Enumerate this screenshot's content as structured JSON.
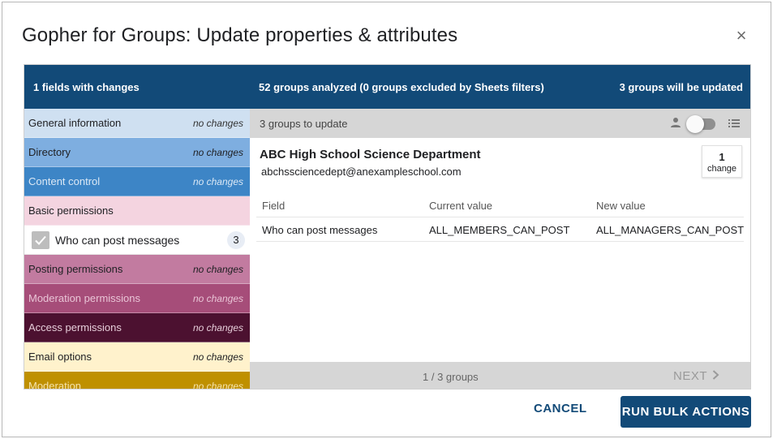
{
  "dialog": {
    "title": "Gopher for Groups: Update properties & attributes",
    "close_label": "×"
  },
  "summary": {
    "fields_with_changes": "1 fields with changes",
    "groups_analyzed": "52 groups analyzed (0 groups excluded by Sheets filters)",
    "groups_will_update": "3 groups will be updated"
  },
  "categories": [
    {
      "name": "General information",
      "status": "no changes",
      "bg": "#cfe0f1",
      "fg": "#202124",
      "nc": "#333333"
    },
    {
      "name": "Directory",
      "status": "no changes",
      "bg": "#7eaee0",
      "fg": "#202124",
      "nc": "#202124"
    },
    {
      "name": "Content control",
      "status": "no changes",
      "bg": "#3d85c6",
      "fg": "#dbe8f5",
      "nc": "#dbe8f5"
    },
    {
      "name": "Basic permissions",
      "status": "",
      "bg": "#f4d4e0",
      "fg": "#202124",
      "nc": "#202124"
    },
    {
      "name": "Posting permissions",
      "status": "no changes",
      "bg": "#c27ba0",
      "fg": "#202124",
      "nc": "#202124"
    },
    {
      "name": "Moderation permissions",
      "status": "no changes",
      "bg": "#a64d79",
      "fg": "#e9c4d6",
      "nc": "#e9c4d6"
    },
    {
      "name": "Access permissions",
      "status": "no changes",
      "bg": "#4c1130",
      "fg": "#e6cdd9",
      "nc": "#e6cdd9"
    },
    {
      "name": "Email options",
      "status": "no changes",
      "bg": "#fff2cc",
      "fg": "#202124",
      "nc": "#202124"
    },
    {
      "name": "Moderation",
      "status": "no changes",
      "bg": "#bf9000",
      "fg": "#f5e3ad",
      "nc": "#f5e3ad"
    }
  ],
  "sub_item": {
    "label": "Who can post messages",
    "count": "3",
    "checked": true
  },
  "preview": {
    "groups_to_update": "3 groups to update",
    "group_name": "ABC High School Science Department",
    "group_email": "abchssciencedept@anexampleschool.com",
    "change_count": "1",
    "change_label": "change",
    "columns": [
      "Field",
      "Current value",
      "New value"
    ],
    "rows": [
      {
        "field": "Who can post messages",
        "current": "ALL_MEMBERS_CAN_POST",
        "new": "ALL_MANAGERS_CAN_POST"
      }
    ],
    "pager": "1 / 3 groups",
    "next_label": "NEXT"
  },
  "actions": {
    "cancel": "CANCEL",
    "run": "RUN BULK ACTIONS"
  },
  "colors": {
    "brand": "#124a78"
  }
}
